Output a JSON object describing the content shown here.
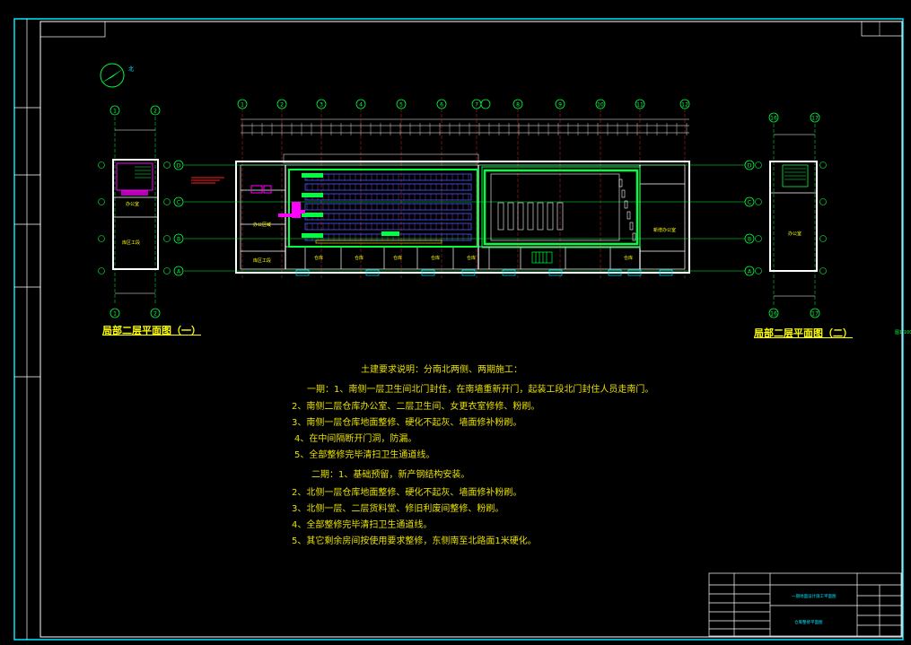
{
  "drawing": {
    "left_title": "局部二层平面图（一）",
    "right_title": "局部二层平面图（二）",
    "axes_top": [
      "1",
      "2",
      "3",
      "4",
      "5",
      "6",
      "7",
      "8",
      "9",
      "10",
      "11",
      "12",
      "13"
    ],
    "axes_side": [
      "D",
      "C",
      "B",
      "A"
    ],
    "left_axes": [
      "1",
      "2"
    ],
    "right_axes": [
      "16",
      "17"
    ]
  },
  "notes": {
    "heading": "土建要求说明：分南北两侧、两期施工：",
    "phase1_title": "一期：1、南侧一层卫生间北门封住，在南墙重新开门，起装工段北门封住人员走南门。",
    "phase1_items": [
      "2、南侧二层仓库办公室、二层卫生间、女更衣室修修、粉刷。",
      "3、南侧一层仓库地面整修、硬化不起灰、墙面修补粉刷。",
      "4、在中间隔断开门洞，防漏。",
      "5、全部整修完毕清扫卫生通道线。"
    ],
    "phase2_title": "二期：1、基础预留，新产钢结构安装。",
    "phase2_items": [
      "2、北侧一层仓库地面整修、硬化不起灰、墙面修补粉刷。",
      "3、北侧一层、二层货料堂、修旧利废间整修、粉刷。",
      "4、全部整修完毕清扫卫生通道线。",
      "5、其它剩余房间按使用要求整修，东侧南至北路面1米硬化。"
    ]
  },
  "colors": {
    "frame": "#00e5ff",
    "wall": "#ffffff",
    "text": "#ffff00",
    "green": "#00ff40",
    "magenta": "#ff00ff",
    "red": "#ff2020"
  }
}
